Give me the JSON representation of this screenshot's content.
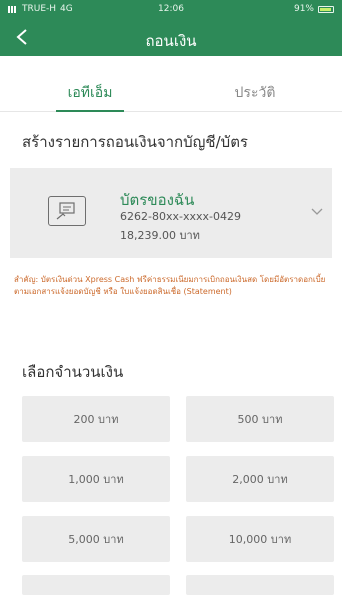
{
  "status_bar": {
    "carrier": "TRUE-H",
    "network": "4G",
    "time": "12:06",
    "battery": "91%",
    "battery_level": 0.91
  },
  "nav": {
    "title": "ถอนเงิน",
    "back_icon": "chevron-left-icon"
  },
  "tabs": [
    {
      "label": "เอทีเอ็ม",
      "active": true
    },
    {
      "label": "ประวัติ",
      "active": false
    }
  ],
  "section_title": "สร้างรายการถอนเงินจากบัญชี/บัตร",
  "card": {
    "name": "บัตรของฉัน",
    "number": "6262-80xx-xxxx-0429",
    "balance": "18,239.00 บาท",
    "icon": "card-icon",
    "dropdown_icon": "chevron-down-icon"
  },
  "note": "สำคัญ: บัตรเงินด่วน Xpress Cash ฟรีค่าธรรมเนียมการเบิกถอนเงินสด โดยมีอัตราดอกเบี้ยตามเอกสารแจ้งยอดบัญชี หรือ ใบแจ้งยอดสินเชื่อ (Statement)",
  "amount_title": "เลือกจำนวนเงิน",
  "amounts": [
    "200 บาท",
    "500 บาท",
    "1,000 บาท",
    "2,000 บาท",
    "5,000 บาท",
    "10,000 บาท"
  ],
  "colors": {
    "brand": "#2d8a58",
    "note": "#cc6a2c",
    "tile": "#ececec"
  }
}
